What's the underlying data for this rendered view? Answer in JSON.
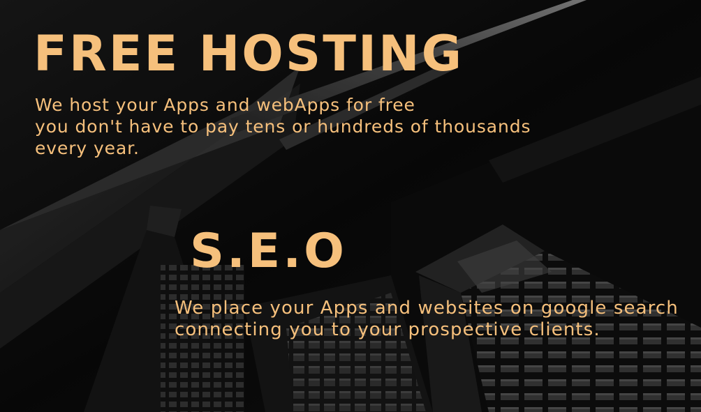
{
  "hosting": {
    "title": "FREE HOSTING",
    "lines": [
      "We host your Apps and webApps for free",
      "you don't have to pay tens or hundreds of thousands",
      "every year."
    ]
  },
  "seo": {
    "title": "S.E.O",
    "lines": [
      "We place your Apps and websites on google search",
      "connecting you to your prospective clients."
    ]
  },
  "colors": {
    "accent": "#f6c07c",
    "background": "#0b0b0b"
  }
}
